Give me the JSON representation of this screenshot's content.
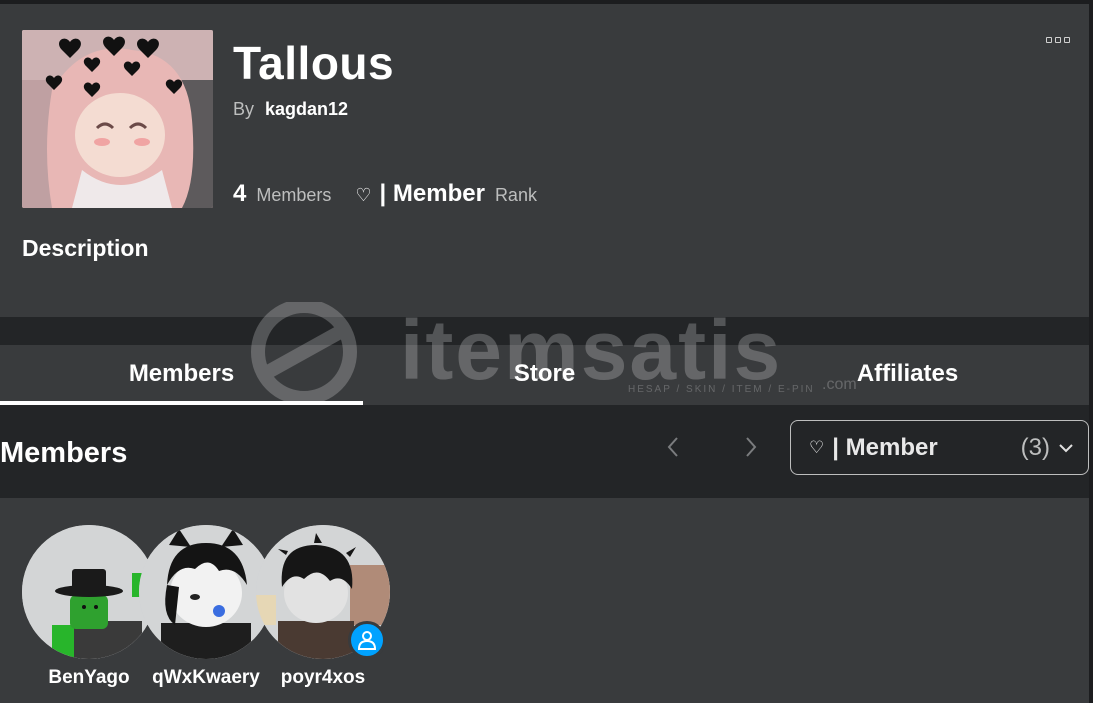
{
  "group": {
    "name": "Tallous",
    "by_label": "By",
    "owner": "kagdan12",
    "member_count": "4",
    "members_label": "Members",
    "rank_icon": "heart-outline",
    "my_rank": "| Member",
    "rank_label": "Rank",
    "description_title": "Description"
  },
  "tabs": [
    {
      "label": "Members",
      "active": true
    },
    {
      "label": "Store",
      "active": false
    },
    {
      "label": "Affiliates",
      "active": false
    }
  ],
  "members_section": {
    "title": "Members",
    "rank_filter": {
      "selected": "| Member",
      "count": "(3)"
    }
  },
  "members": [
    {
      "name": "BenYago"
    },
    {
      "name": "qWxKwaery"
    },
    {
      "name": "poyr4xos"
    }
  ],
  "watermark": {
    "text": "itemsatis",
    "sub": "HESAP / SKIN / ITEM / E-PIN",
    "suffix": ".com"
  },
  "colors": {
    "background": "#232527",
    "card": "#393b3d",
    "text": "#ffffff",
    "muted": "#bdbebe",
    "presence_blue": "#00a2ff"
  }
}
